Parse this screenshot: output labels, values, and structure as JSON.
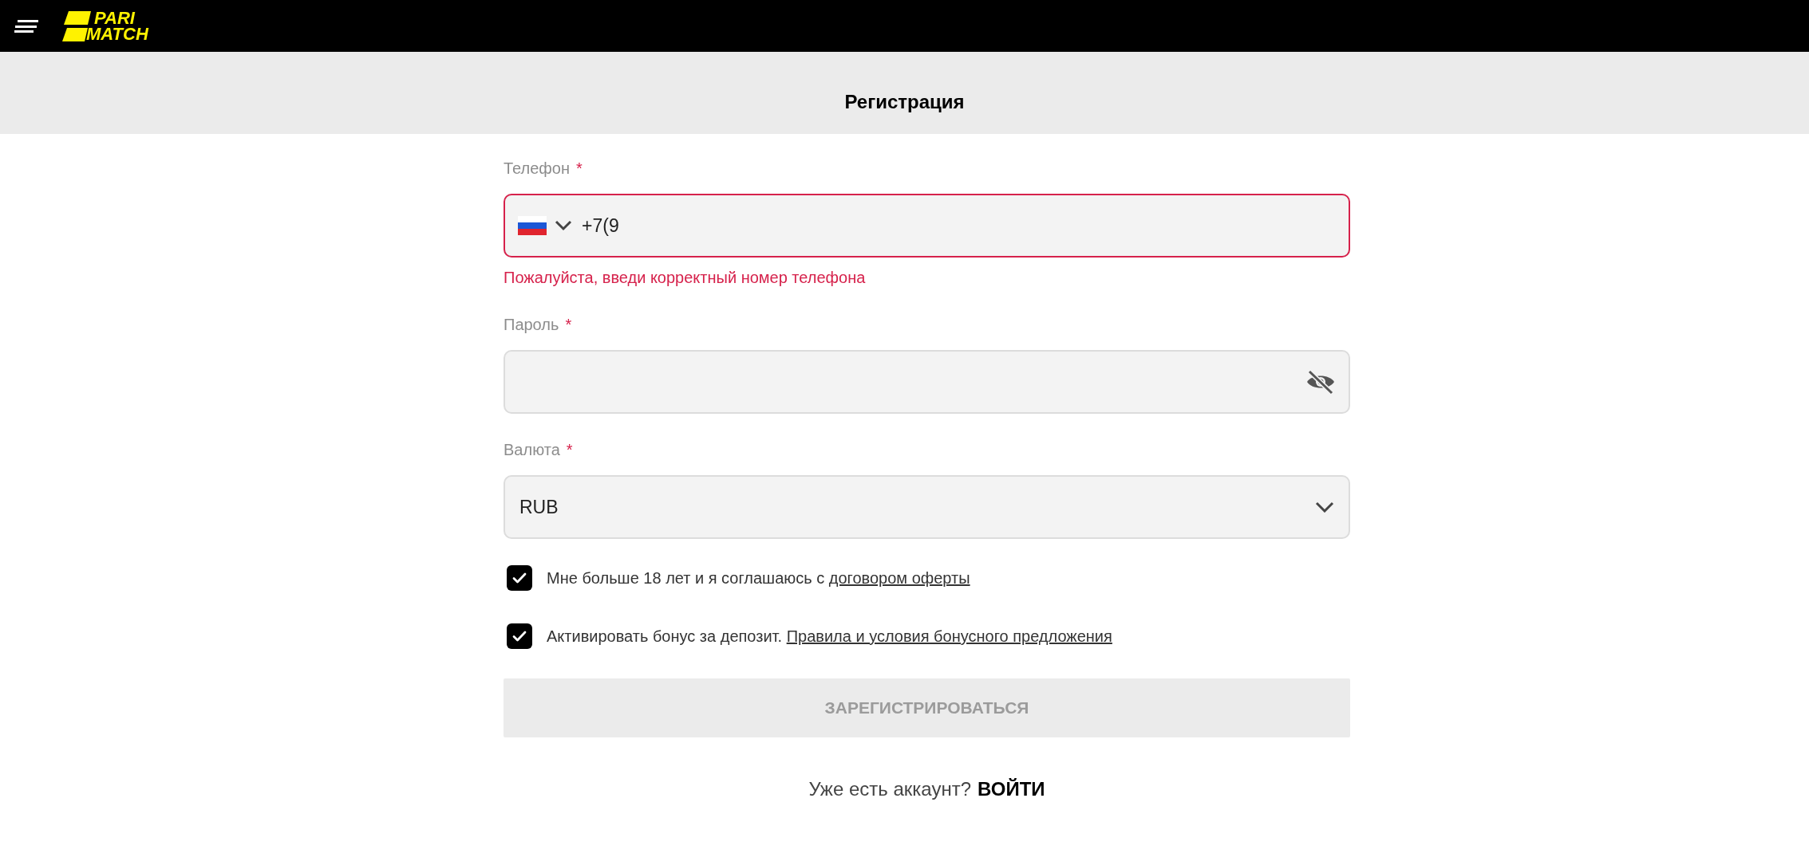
{
  "header": {
    "logo": {
      "line_1": "PARI",
      "line_2": "MATCH"
    }
  },
  "page_title": "Регистрация",
  "form": {
    "phone": {
      "label": "Телефон",
      "required_mark": "*",
      "value": "+7(9",
      "invalid": true,
      "error": "Пожалуйста, введи корректный номер телефона"
    },
    "password": {
      "label": "Пароль",
      "required_mark": "*"
    },
    "currency": {
      "label": "Валюта",
      "required_mark": "*",
      "value": "RUB"
    },
    "agreements": [
      {
        "text": "Мне больше 18 лет и я соглашаюсь с",
        "link": "договором оферты",
        "checked": true
      },
      {
        "text": "Активировать бонус за депозит.",
        "link": "Правила и условия бонусного предложения",
        "checked": true
      }
    ],
    "submit": {
      "label": "ЗАРЕГИСТРИРОВАТЬСЯ",
      "disabled": true
    },
    "login_prompt": {
      "text": "Уже есть аккаунт?",
      "link": "ВОЙТИ"
    }
  }
}
